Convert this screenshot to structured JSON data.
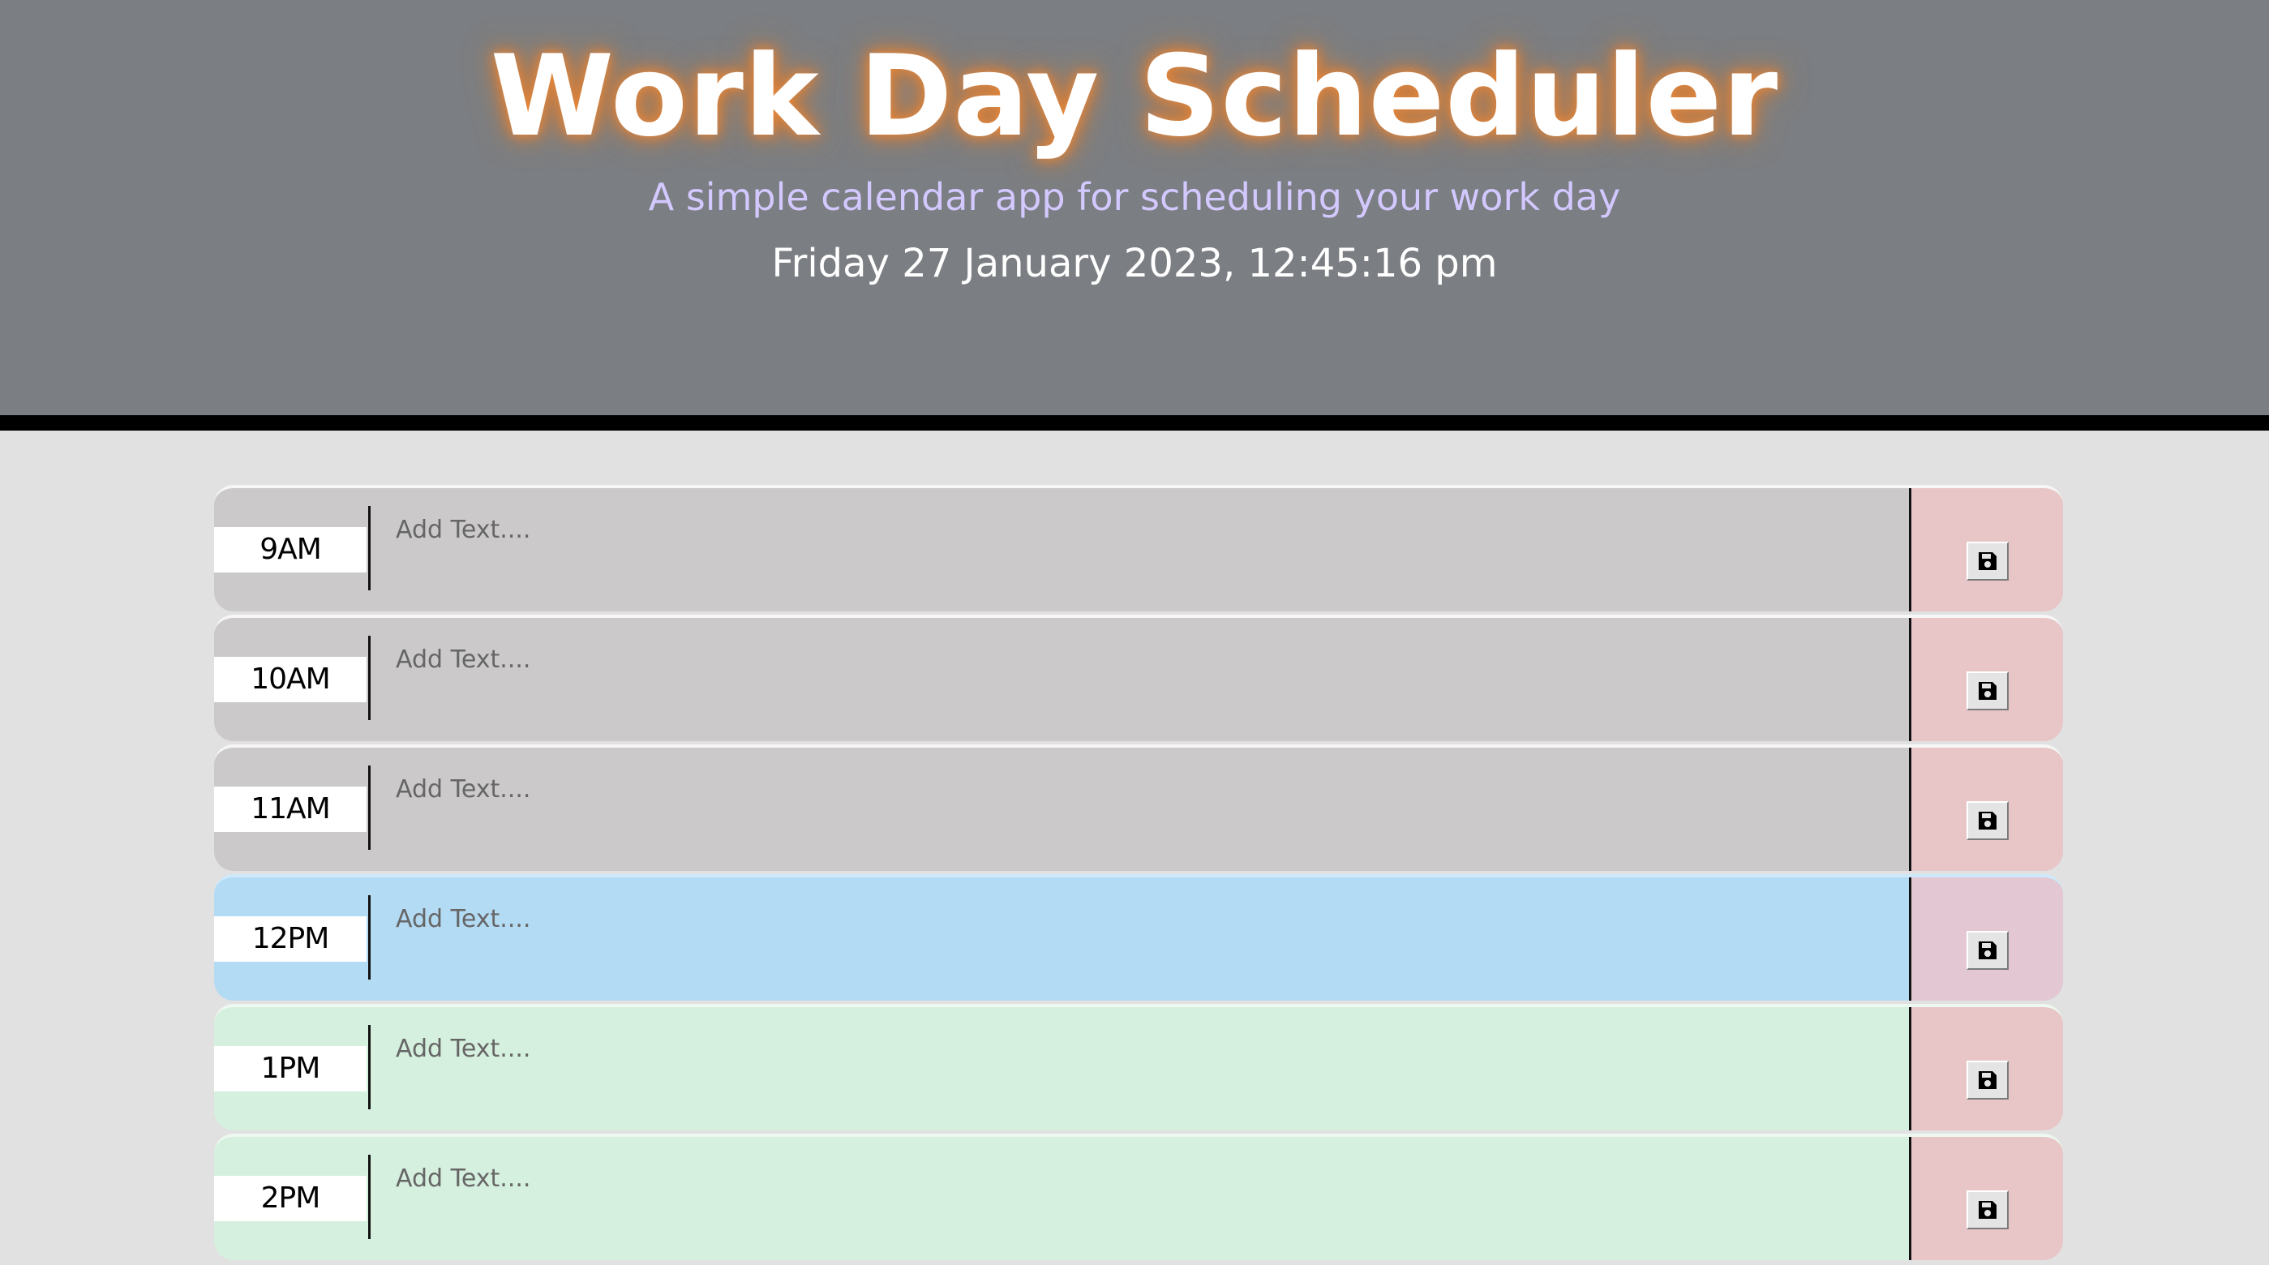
{
  "header": {
    "title": "Work Day Scheduler",
    "subtitle": "A simple calendar app for scheduling your work day",
    "datetime": "Friday 27 January 2023, 12:45:16 pm"
  },
  "colors": {
    "header_bg": "#7b7e82",
    "title_glow": "#e98a3e",
    "subtitle": "#d3c8ff",
    "past": "#cbc9ca",
    "present": "#b3dbf4",
    "future": "#d5f0de",
    "save_cell": "#e8c6c8"
  },
  "schedule": {
    "placeholder": "Add Text....",
    "save_icon": "floppy-disk-icon",
    "rows": [
      {
        "hour": "9AM",
        "status": "past",
        "text": ""
      },
      {
        "hour": "10AM",
        "status": "past",
        "text": ""
      },
      {
        "hour": "11AM",
        "status": "past",
        "text": ""
      },
      {
        "hour": "12PM",
        "status": "present",
        "text": ""
      },
      {
        "hour": "1PM",
        "status": "future",
        "text": ""
      },
      {
        "hour": "2PM",
        "status": "future",
        "text": ""
      }
    ]
  }
}
